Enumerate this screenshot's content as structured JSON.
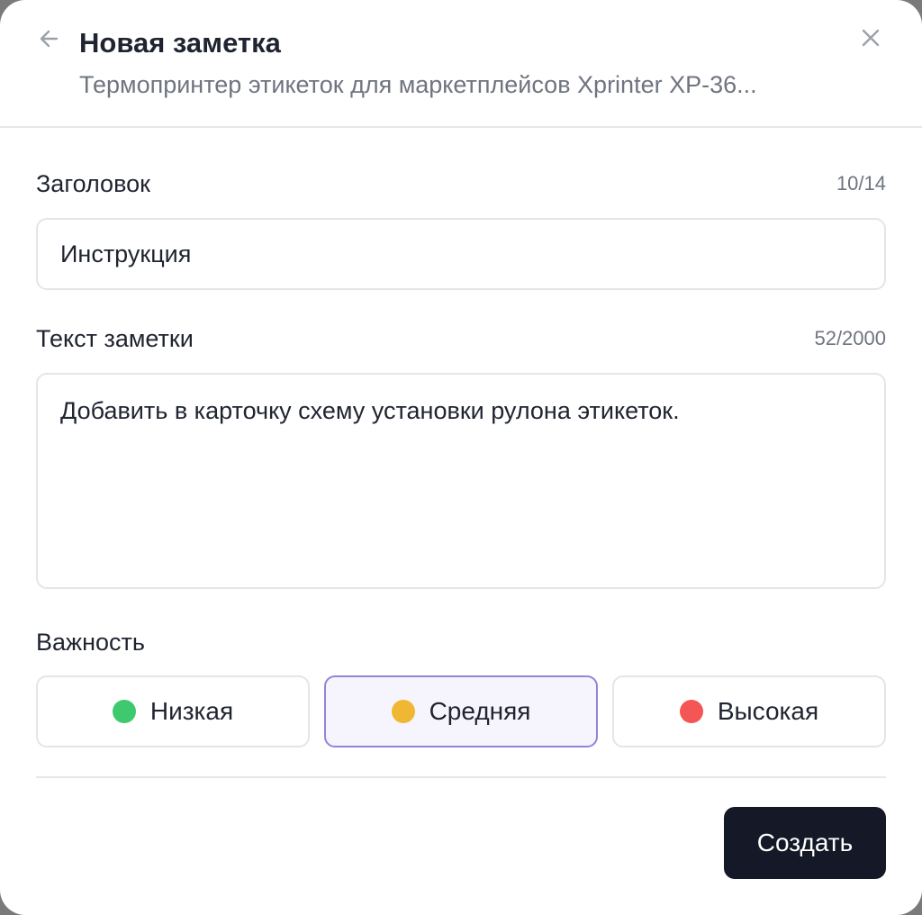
{
  "header": {
    "title": "Новая заметка",
    "subtitle": "Термопринтер этикеток для маркетплейсов Xprinter XP-36...",
    "back_icon": "arrow-left-icon",
    "close_icon": "close-icon"
  },
  "title_field": {
    "label": "Заголовок",
    "counter": "10/14",
    "value": "Инструкция"
  },
  "text_field": {
    "label": "Текст заметки",
    "counter": "52/2000",
    "value": "Добавить в карточку схему установки рулона этикеток."
  },
  "importance": {
    "label": "Важность",
    "selected": "Средняя",
    "options": [
      {
        "label": "Низкая",
        "color": "#3fc96e"
      },
      {
        "label": "Средняя",
        "color": "#f0b732"
      },
      {
        "label": "Высокая",
        "color": "#f45555"
      }
    ]
  },
  "footer": {
    "create_label": "Создать"
  },
  "colors": {
    "primary_button": "#141827",
    "selected_border": "#8f86d6",
    "selected_bg": "#f6f5fd"
  }
}
